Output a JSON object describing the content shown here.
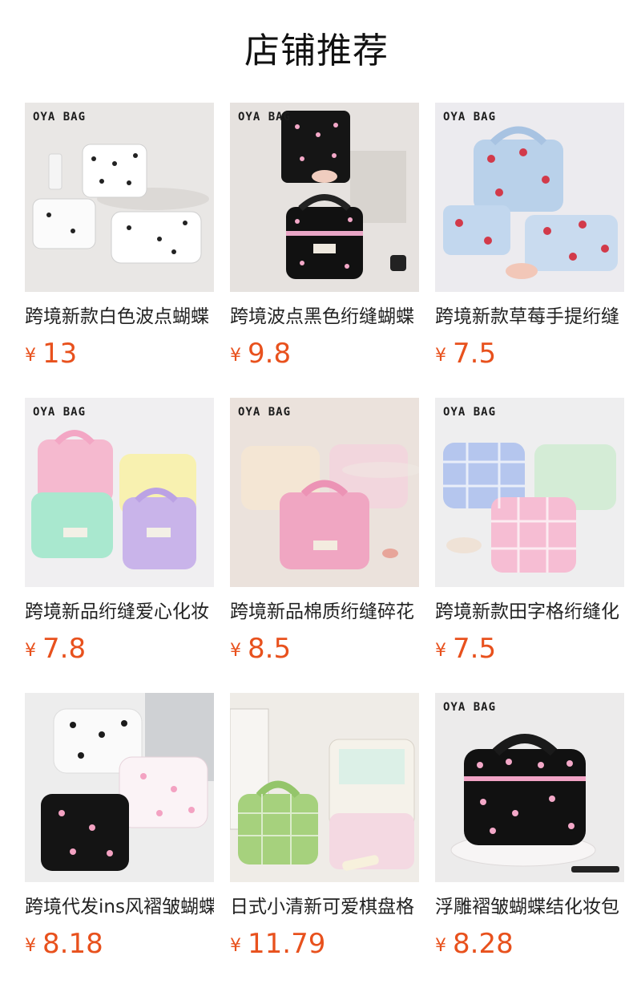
{
  "header": {
    "title": "店铺推荐"
  },
  "currency_symbol": "¥",
  "products": [
    {
      "brand": "OYA BAG",
      "name": "跨境新款白色波点蝴蝶",
      "price": "13",
      "theme": "white-bow"
    },
    {
      "brand": "OYA BAG",
      "name": "跨境波点黑色绗缝蝴蝶",
      "price": "9.8",
      "theme": "black-dot"
    },
    {
      "brand": "OYA BAG",
      "name": "跨境新款草莓手提绗缝",
      "price": "7.5",
      "theme": "strawberry"
    },
    {
      "brand": "OYA BAG",
      "name": "跨境新品绗缝爱心化妆",
      "price": "7.8",
      "theme": "pastel-heart"
    },
    {
      "brand": "OYA BAG",
      "name": "跨境新品棉质绗缝碎花",
      "price": "8.5",
      "theme": "pink-floral"
    },
    {
      "brand": "OYA BAG",
      "name": "跨境新款田字格绗缝化",
      "price": "7.5",
      "theme": "plaid"
    },
    {
      "brand": "",
      "name": "跨境代发ins风褶皱蝴蝶",
      "price": "8.18",
      "theme": "bow-pouch"
    },
    {
      "brand": "",
      "name": "日式小清新可爱棋盘格",
      "price": "11.79",
      "theme": "gingham"
    },
    {
      "brand": "OYA BAG",
      "name": "浮雕褶皱蝴蝶结化妆包",
      "price": "8.28",
      "theme": "black-bow"
    }
  ],
  "colors": {
    "price": "#e8511d",
    "title": "#111111"
  }
}
